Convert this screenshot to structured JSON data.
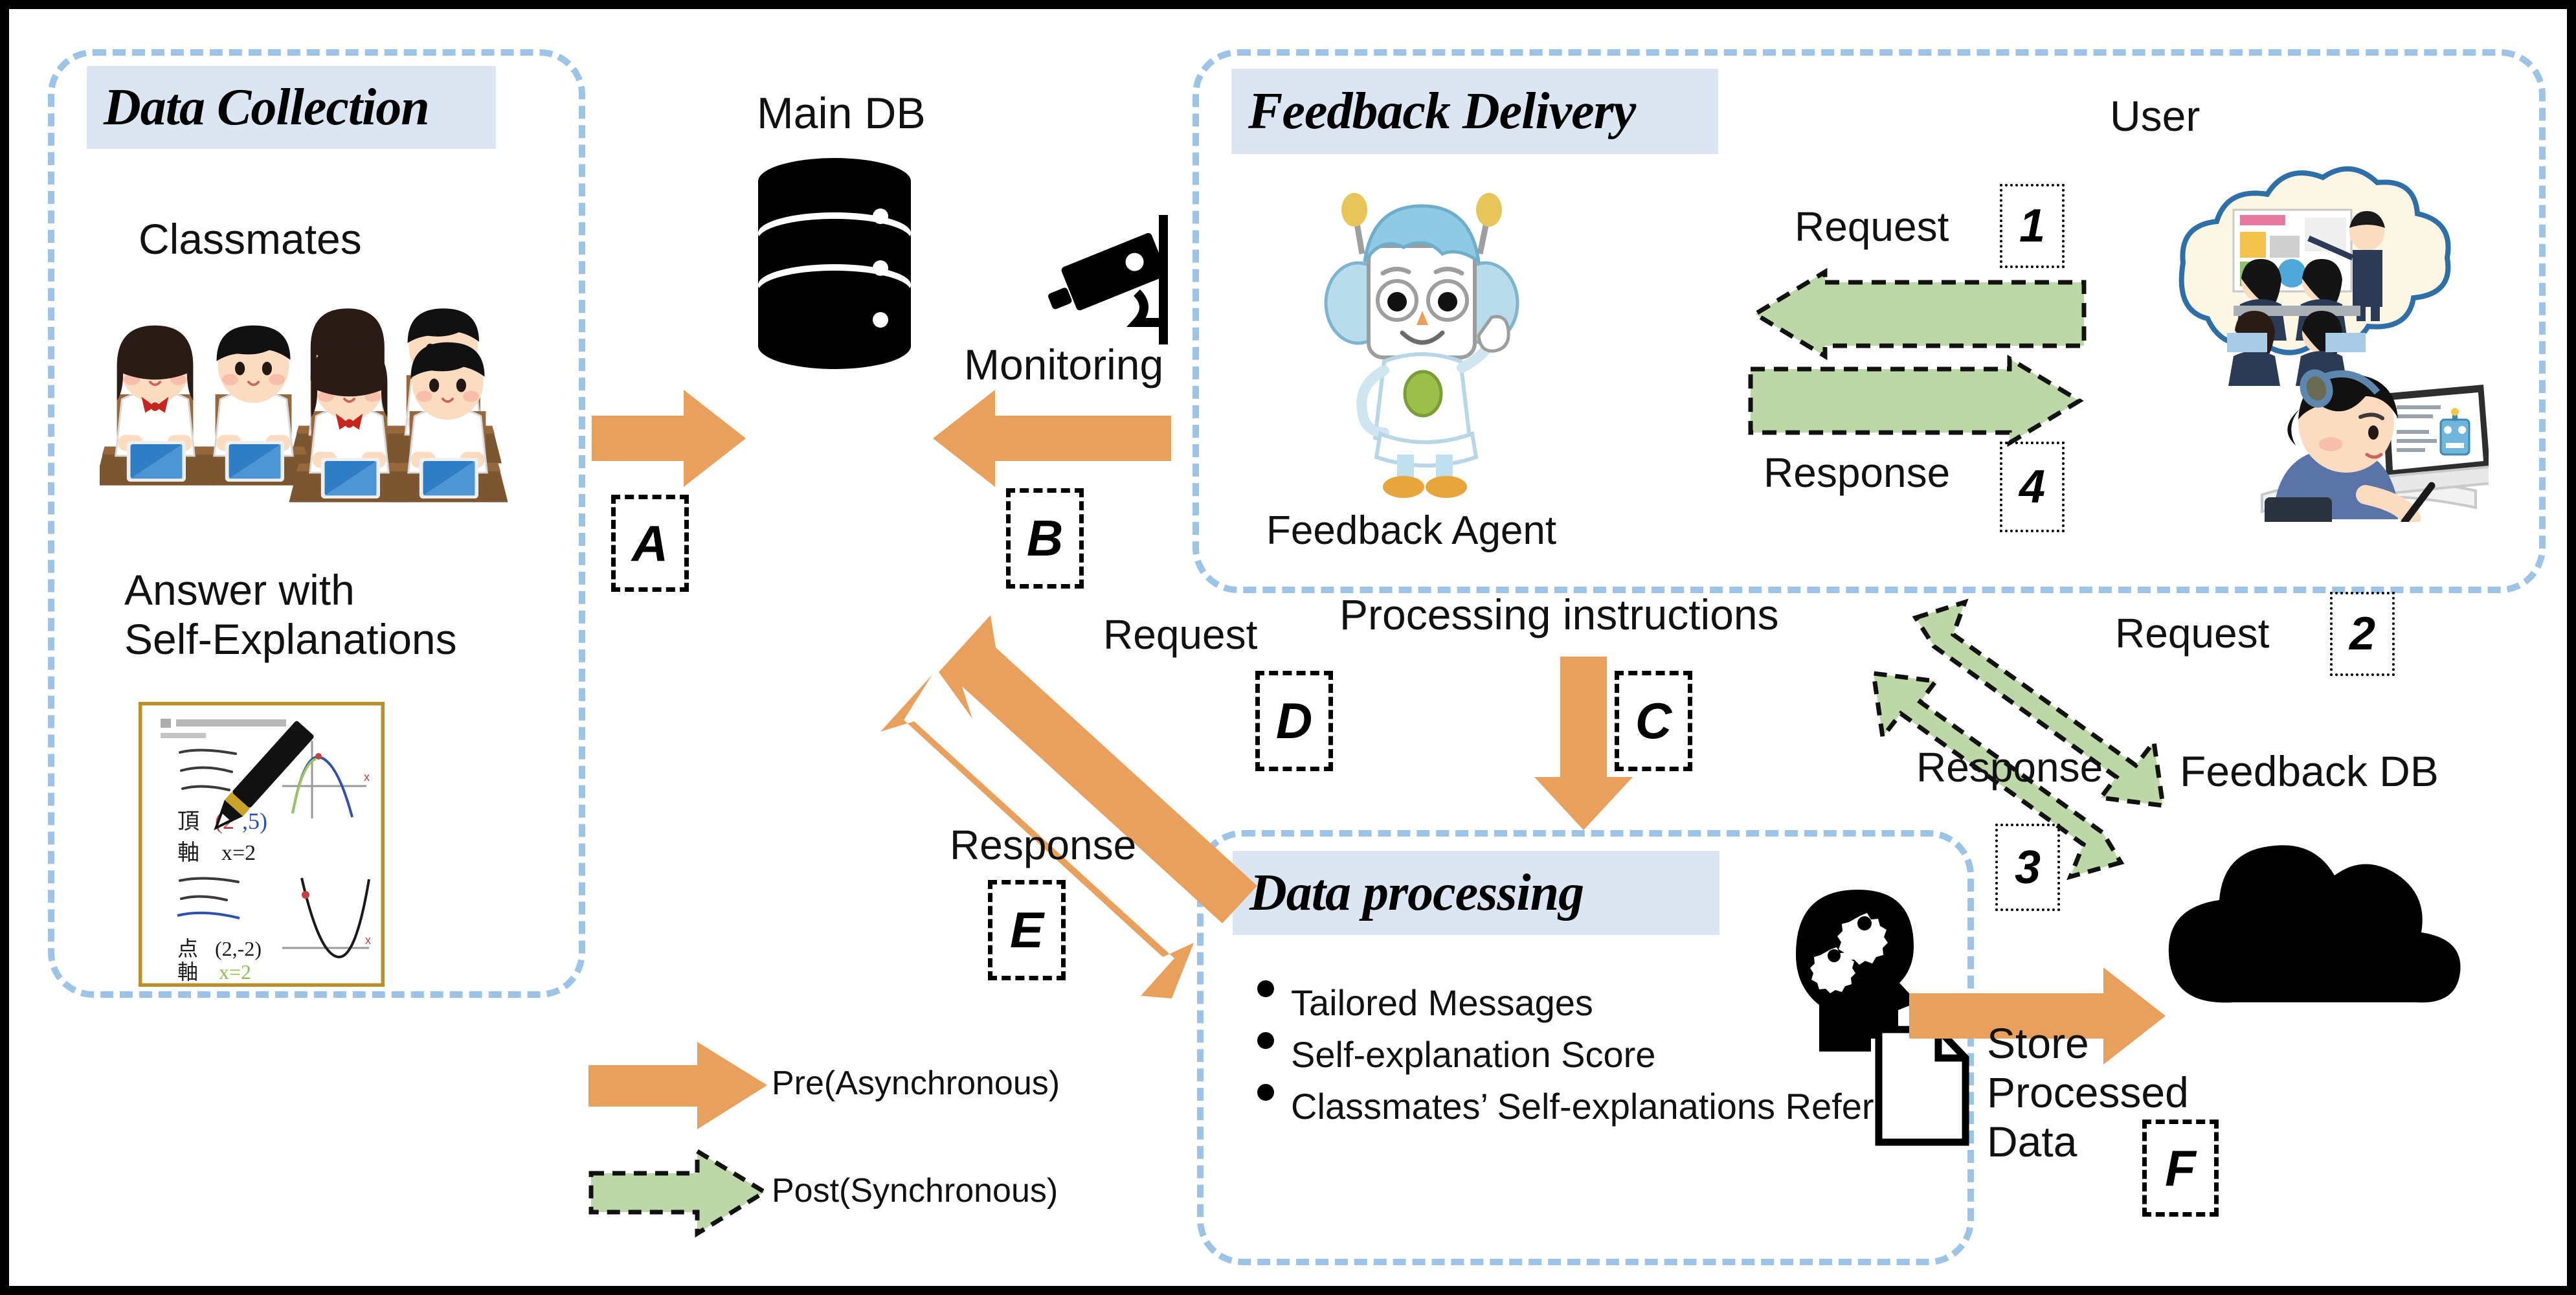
{
  "panels": {
    "data_collection": {
      "title": "Data Collection",
      "classmates_label": "Classmates",
      "answer_label_line1": "Answer with",
      "answer_label_line2": "Self-Explanations"
    },
    "feedback_delivery": {
      "title": "Feedback Delivery",
      "agent_label": "Feedback Agent",
      "user_label": "User",
      "request_label": "Request",
      "request_step": "1",
      "response_label": "Response",
      "response_step": "4"
    },
    "data_processing": {
      "title": "Data processing",
      "bullets": [
        "Tailored Messages",
        "Self-explanation Score",
        "Classmates’ Self-explanations Reference"
      ]
    }
  },
  "nodes": {
    "main_db": "Main DB",
    "feedback_db": "Feedback  DB",
    "monitoring": "Monitoring",
    "processing_instructions": "Processing instructions",
    "store_processed_data_line1": "Store",
    "store_processed_data_line2": "Processed",
    "store_processed_data_line3": "Data"
  },
  "flows": {
    "a": "A",
    "b": "B",
    "c": "C",
    "d": "D",
    "e": "E",
    "f": "F",
    "db_request_label": "Request",
    "db_response_label": "Response",
    "fb_request_label": "Request",
    "fb_request_step": "2",
    "fb_response_label": "Response",
    "fb_response_step": "3"
  },
  "legend": {
    "pre": "Pre(Asynchronous)",
    "post": "Post(Synchronous)"
  },
  "colors": {
    "orange": "#E8A05C",
    "green_fill": "#BED7A8",
    "panel_border": "#9DC3E6",
    "title_bg": "#DCE6F2",
    "ink": "#000000"
  }
}
